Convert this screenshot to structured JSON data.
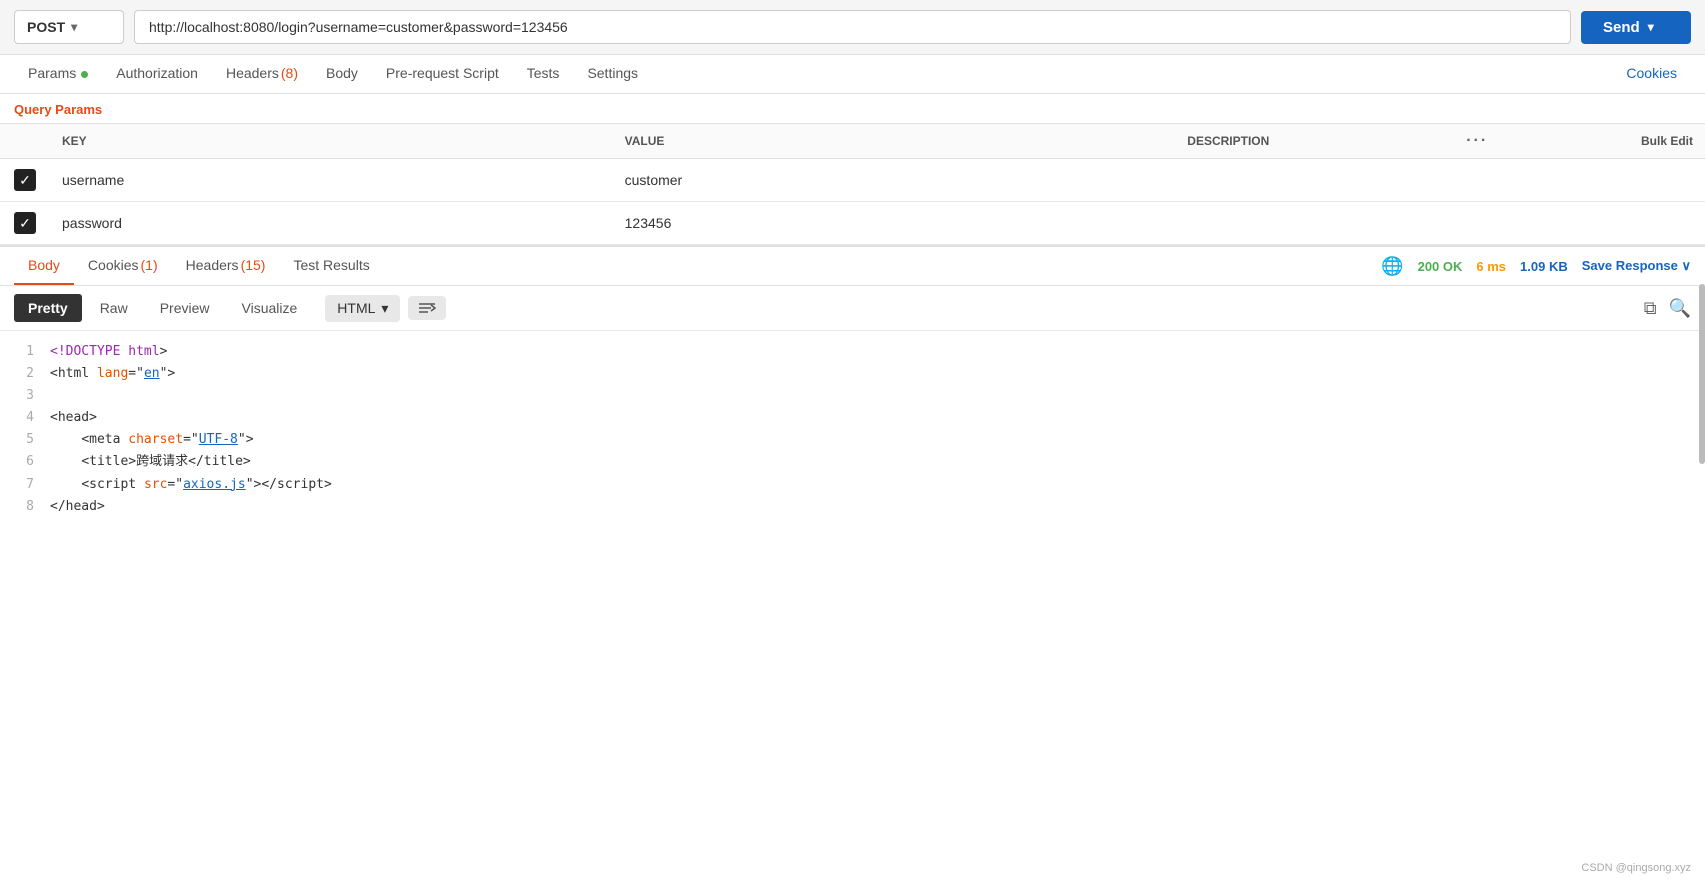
{
  "topbar": {
    "method": "POST",
    "method_chevron": "▾",
    "url": "http://localhost:8080/login?username=customer&password=123456",
    "send_label": "Send",
    "send_chevron": "▾"
  },
  "req_tabs": {
    "params_label": "Params",
    "authorization_label": "Authorization",
    "headers_label": "Headers",
    "headers_count": "(8)",
    "body_label": "Body",
    "prerequest_label": "Pre-request Script",
    "tests_label": "Tests",
    "settings_label": "Settings",
    "cookies_label": "Cookies"
  },
  "query_params": {
    "section_title": "Query Params",
    "columns": {
      "key": "KEY",
      "value": "VALUE",
      "description": "DESCRIPTION",
      "bulk_edit": "Bulk Edit"
    },
    "rows": [
      {
        "checked": true,
        "key": "username",
        "value": "customer",
        "description": ""
      },
      {
        "checked": true,
        "key": "password",
        "value": "123456",
        "description": ""
      }
    ]
  },
  "response_tabs": {
    "body_label": "Body",
    "cookies_label": "Cookies",
    "cookies_count": "(1)",
    "headers_label": "Headers",
    "headers_count": "(15)",
    "test_results_label": "Test Results",
    "status": "200 OK",
    "time": "6 ms",
    "size": "1.09 KB",
    "save_response_label": "Save Response",
    "save_chevron": "∨"
  },
  "format_bar": {
    "pretty_label": "Pretty",
    "raw_label": "Raw",
    "preview_label": "Preview",
    "visualize_label": "Visualize",
    "format_type": "HTML",
    "format_chevron": "▾"
  },
  "code_lines": [
    {
      "num": "1",
      "html": "<span class='doctype'>&lt;!DOCTYPE</span> <span class='kw'>html</span><span class='tag-br'>&gt;</span>"
    },
    {
      "num": "2",
      "html": "<span class='tag'>&lt;html</span> <span class='attr'>lang</span><span class='tag'>=\"</span><span class='attr-val'>en</span><span class='tag'>\"&gt;</span>"
    },
    {
      "num": "3",
      "html": ""
    },
    {
      "num": "4",
      "html": "<span class='tag'>&lt;head&gt;</span>"
    },
    {
      "num": "5",
      "html": "&nbsp;&nbsp;&nbsp;&nbsp;<span class='tag'>&lt;meta</span> <span class='attr'>charset</span><span class='tag'>=\"</span><span class='attr-val'>UTF-8</span><span class='tag'>\"&gt;</span>"
    },
    {
      "num": "6",
      "html": "&nbsp;&nbsp;&nbsp;&nbsp;<span class='tag'>&lt;title&gt;</span><span class='chinese'>跨域请求</span><span class='tag'>&lt;/title&gt;</span>"
    },
    {
      "num": "7",
      "html": "&nbsp;&nbsp;&nbsp;&nbsp;<span class='tag'>&lt;script</span> <span class='attr'>src</span><span class='tag'>=\"</span><span class='link'>axios.js</span><span class='tag'>\"&gt;&lt;/script&gt;</span>"
    },
    {
      "num": "8",
      "html": "<span class='tag'>&lt;/head&gt;</span>"
    }
  ],
  "watermark": "CSDN @qingsong.xyz"
}
